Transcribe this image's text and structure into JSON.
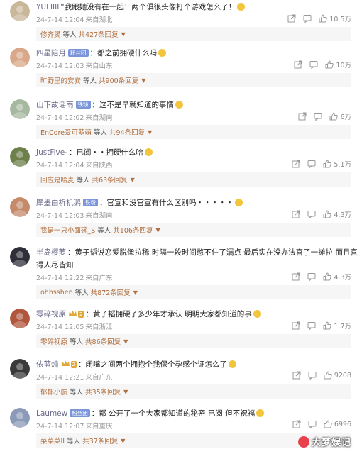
{
  "comments": [
    {
      "username": "YULIIII",
      "badge": "",
      "level": "",
      "text": "“我跟她没有在一起！两个俱很头像打个游戏怎么了！",
      "text2": "",
      "time": "24-7-14 12:04",
      "location": "来自湖北",
      "likes": "10.5万",
      "reply_name": "修齐煲",
      "reply_sep": "等人",
      "reply_count": "共427条回复",
      "avatar_color": "#c9b79a"
    },
    {
      "username": "四星陪月",
      "badge": "粉丝团",
      "level": "",
      "text": "：都之前拥硬什么吗",
      "text2": "",
      "time": "24-7-14 12:03",
      "location": "来自山东",
      "likes": "10万",
      "reply_name": "旷野里的安安",
      "reply_sep": "等人",
      "reply_count": "共900条回复",
      "avatar_color": "#d9a88a"
    },
    {
      "username": "山下故谣雨",
      "badge": "铁粉",
      "level": "",
      "text": "：这不是早就知道的事情",
      "text2": "",
      "time": "24-7-14 12:02",
      "location": "来自湖南",
      "likes": "6万",
      "reply_name": "EnCore爱可萌萌",
      "reply_sep": "等人",
      "reply_count": "共94条回复",
      "avatar_color": "#a7b8a0"
    },
    {
      "username": "JustFive-",
      "badge": "",
      "level": "",
      "text": "：已阅・・拥硬什么哈",
      "text2": "",
      "time": "24-7-14 12:04",
      "location": "来自陕西",
      "likes": "5.1万",
      "reply_name": "回应是哈麦",
      "reply_sep": "等人",
      "reply_count": "共63条回复",
      "avatar_color": "#6d7f4a"
    },
    {
      "username": "摩墨由祈机鹅",
      "badge": "铁粉",
      "level": "",
      "text": "：官宣和没官宣有什么区别吗・・・・・",
      "text2": "",
      "time": "24-7-14 12:03",
      "location": "来自湖南",
      "likes": "4.3万",
      "reply_name": "我是一只小面碗_S",
      "reply_sep": "等人",
      "reply_count": "共106条回复",
      "avatar_color": "#c48a6a"
    },
    {
      "username": "半岛樱萝",
      "badge": "",
      "level": "",
      "text": "：黄子韬说恋爱脱像拉稀 时隔一段时间憋不住了漏点 最后实在没办法喜了一摊拉 而且喜",
      "text2": "得人尽皆知",
      "time": "24-7-14 12:22",
      "location": "来自广东",
      "likes": "4.3万",
      "reply_name": "ohhsshen",
      "reply_sep": "等人",
      "reply_count": "共872条回复",
      "avatar_color": "#2f2f3a"
    },
    {
      "username": "零碎视原",
      "badge": "",
      "level": "2",
      "text": "：黄子韬拥硬了多少年才承认 明明大家都知道的事",
      "text2": "",
      "time": "24-7-14 12:05",
      "location": "来自浙江",
      "likes": "1.7万",
      "reply_name": "零碎视原",
      "reply_sep": "等人",
      "reply_count": "共86条回复",
      "avatar_color": "#b0563d"
    },
    {
      "username": "依蓝炖",
      "badge": "",
      "level": "2",
      "text": "：闭嘴之间两个拥抱个我保个孕感个证怎么了",
      "text2": "",
      "time": "24-7-14 12:21",
      "location": "来自广东",
      "likes": "9208",
      "reply_name": "郁郁小航",
      "reply_sep": "等人",
      "reply_count": "共35条回复",
      "avatar_color": "#3a3a3a"
    },
    {
      "username": "Laumew",
      "badge": "粉丝团",
      "level": "",
      "text": "：都 公开了一个大家都知道的秘密 已阅 但不祝福",
      "text2": "",
      "time": "24-7-14 12:07",
      "location": "来自重庆",
      "likes": "6996",
      "reply_name": "菜菜菜II",
      "reply_sep": "等人",
      "reply_count": "共37条回复",
      "avatar_color": "#8a9ab8"
    }
  ],
  "watermark": "大梦娱记",
  "icons": {
    "share": "share-icon",
    "comment": "comment-icon",
    "like": "thumb-up-icon",
    "caret": "caret-down-icon"
  },
  "colors": {
    "reply_link": "#b06d3d",
    "username": "#6a6a8a",
    "meta": "#999999"
  }
}
